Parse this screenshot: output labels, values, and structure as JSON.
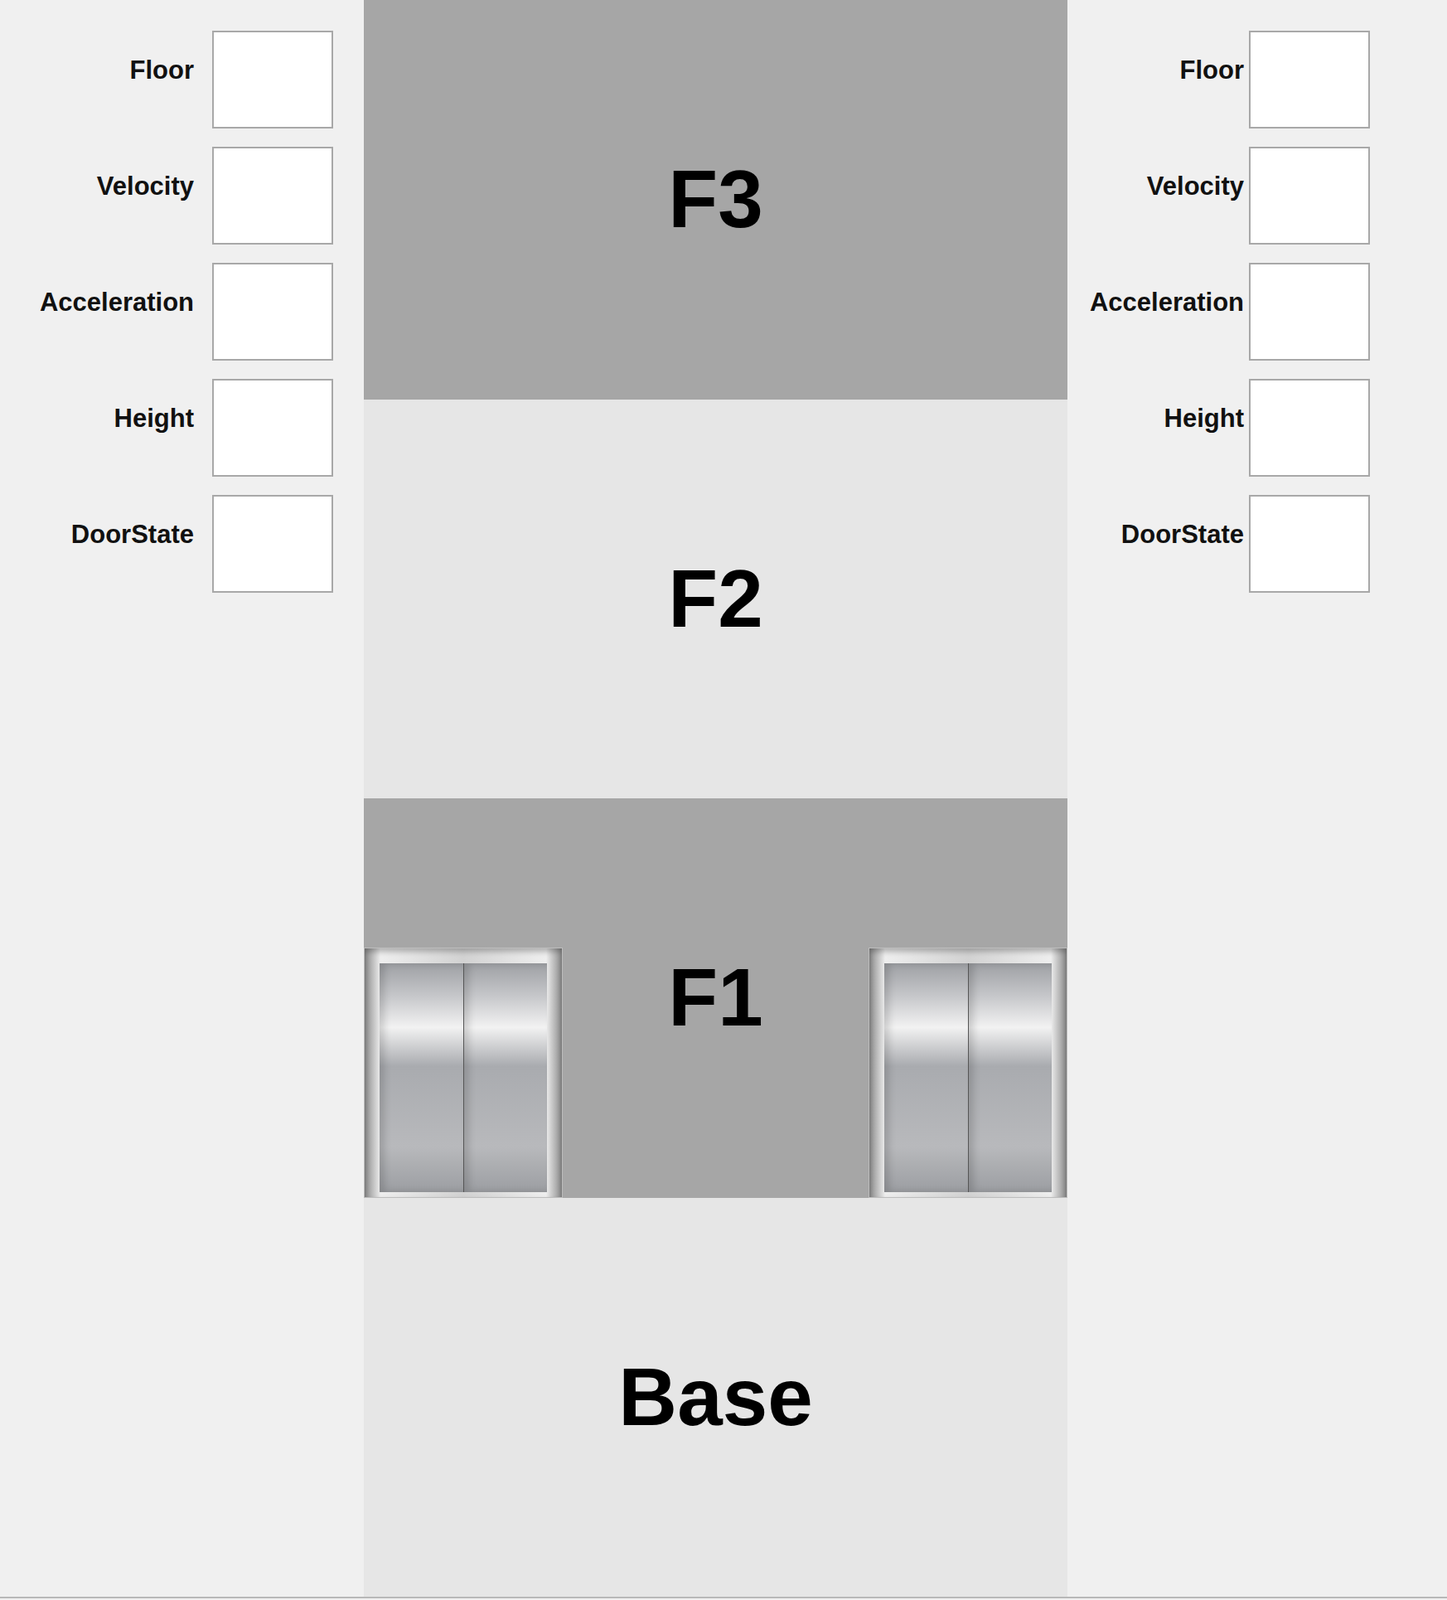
{
  "panels": [
    {
      "side": "left",
      "fields": [
        {
          "label": "Floor",
          "value": ""
        },
        {
          "label": "Velocity",
          "value": ""
        },
        {
          "label": "Acceleration",
          "value": ""
        },
        {
          "label": "Height",
          "value": ""
        },
        {
          "label": "DoorState",
          "value": ""
        }
      ]
    },
    {
      "side": "right",
      "fields": [
        {
          "label": "Floor",
          "value": ""
        },
        {
          "label": "Velocity",
          "value": ""
        },
        {
          "label": "Acceleration",
          "value": ""
        },
        {
          "label": "Height",
          "value": ""
        },
        {
          "label": "DoorState",
          "value": ""
        }
      ]
    }
  ],
  "floors": [
    {
      "label": "F3",
      "shade": "dark"
    },
    {
      "label": "F2",
      "shade": "light"
    },
    {
      "label": "F1",
      "shade": "dark"
    },
    {
      "label": "Base",
      "shade": "light"
    }
  ],
  "elevators": [
    {
      "side": "left",
      "at_floor": "F1"
    },
    {
      "side": "right",
      "at_floor": "F1"
    }
  ]
}
